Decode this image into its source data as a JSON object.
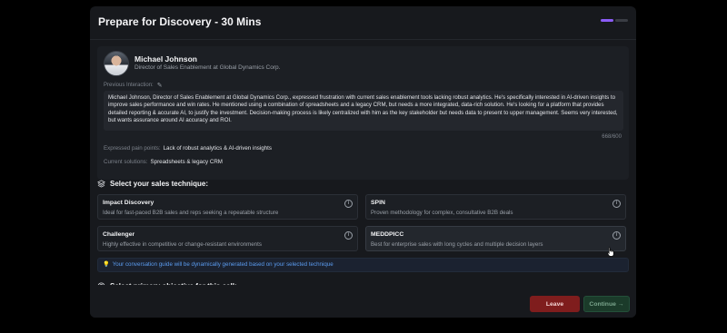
{
  "modal": {
    "title": "Prepare for Discovery - 30 Mins",
    "progress": [
      true,
      false
    ]
  },
  "profile": {
    "name": "Michael Johnson",
    "role": "Director of Sales Enablement at Global Dynamics Corp.",
    "previous_label": "Previous Interaction:",
    "previous_text": "Michael Johnson, Director of Sales Enablement at Global Dynamics Corp., expressed frustration with current sales enablement tools lacking robust analytics. He's specifically interested in AI-driven insights to improve sales performance and win rates.  He mentioned using a combination of spreadsheets and a legacy CRM, but needs a more integrated, data-rich solution.  He's looking for a platform that provides detailed reporting & accurate AI, to justify the investment.  Decision-making process is likely centralized with him as the key stakeholder but needs data to present to upper management. Seems very interested, but wants assurance around AI accuracy and ROI.",
    "counter": "668/600",
    "pain_label": "Expressed pain points:",
    "pain_value": "Lack of robust analytics & AI-driven insights",
    "solutions_label": "Current solutions:",
    "solutions_value": "Spreadsheets & legacy CRM"
  },
  "technique": {
    "heading": "Select your sales technique:",
    "icon": "layers-icon",
    "cards": [
      {
        "title": "Impact Discovery",
        "desc": "Ideal for fast-paced B2B sales and reps seeking a repeatable structure"
      },
      {
        "title": "SPIN",
        "desc": "Proven methodology for complex, consultative B2B deals"
      },
      {
        "title": "Challenger",
        "desc": "Highly effective in competitive or change-resistant environments"
      },
      {
        "title": "MEDDPICC",
        "desc": "Best for enterprise sales with long cycles and multiple decision layers"
      }
    ],
    "note": "Your conversation guide will be dynamically generated based on your selected technique"
  },
  "objective": {
    "heading": "Select primary objective for this call:",
    "icon": "target-icon"
  },
  "footer": {
    "leave_label": "Leave",
    "continue_label": "Continue →"
  },
  "colors": {
    "accent": "#8b5cf6",
    "leave": "#7f1d1d",
    "continue": "#1b3b2a",
    "note_text": "#5b9cf0"
  }
}
